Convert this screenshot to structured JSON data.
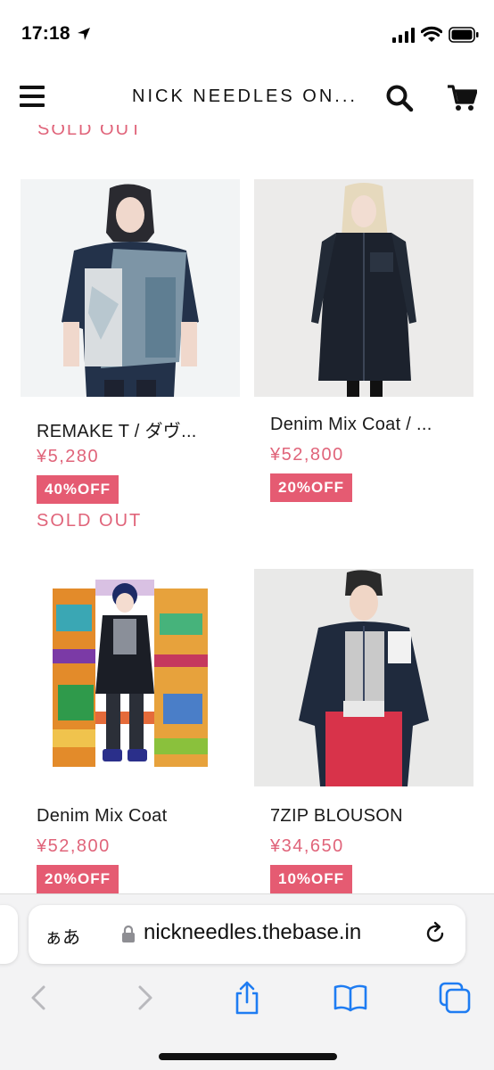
{
  "status_bar": {
    "time": "17:18"
  },
  "header": {
    "title": "NICK NEEDLES ON..."
  },
  "top_sold_out": "SOLD OUT",
  "products": [
    {
      "name": "REMAKE T / ダヴ...",
      "price": "¥5,280",
      "discount": "40%OFF",
      "sold_out": "SOLD OUT"
    },
    {
      "name": "Denim Mix Coat / ...",
      "price": "¥52,800",
      "discount": "20%OFF",
      "sold_out": ""
    },
    {
      "name": "Denim Mix Coat",
      "price": "¥52,800",
      "discount": "20%OFF",
      "sold_out": ""
    },
    {
      "name": "7ZIP BLOUSON",
      "price": "¥34,650",
      "discount": "10%OFF",
      "sold_out": ""
    }
  ],
  "browser": {
    "aa_label": "ぁあ",
    "url": "nickneedles.thebase.in"
  },
  "colors": {
    "accent_pink": "#e0647a",
    "badge_pink": "#e55b72",
    "ios_blue": "#1e7cf2",
    "ios_disabled": "#b9b9bd"
  }
}
